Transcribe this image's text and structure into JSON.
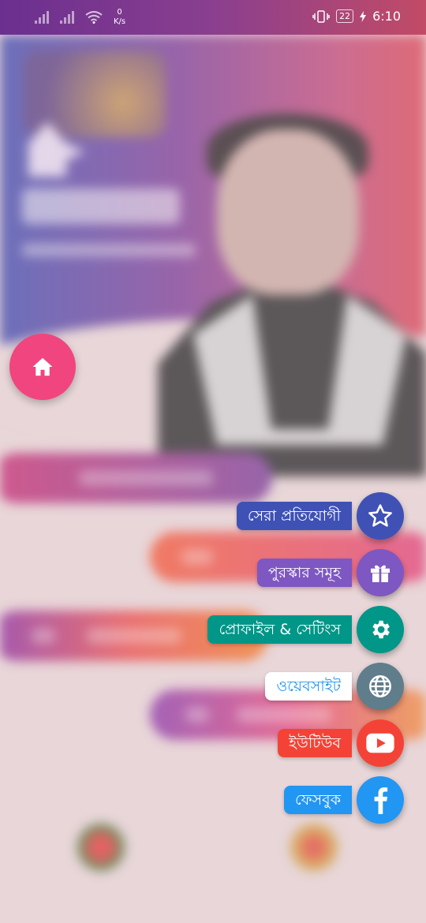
{
  "status_bar": {
    "net_speed_value": "0",
    "net_speed_unit": "K/s",
    "battery": "22",
    "time": "6:10"
  },
  "home_button": {
    "icon": "home-icon",
    "color": "#f1457f"
  },
  "speed_dial": [
    {
      "label": "সেরা প্রতিযোগী",
      "icon": "star-icon",
      "label_bg": "#3f51b5",
      "label_fg": "#ffffff",
      "btn_bg": "#3f51b5"
    },
    {
      "label": "পুরস্কার সমূহ",
      "icon": "gift-icon",
      "label_bg": "#7e57c2",
      "label_fg": "#ffffff",
      "btn_bg": "#7e57c2"
    },
    {
      "label": "প্রোফাইল & সেটিংস",
      "icon": "gear-icon",
      "label_bg": "#009688",
      "label_fg": "#ffffff",
      "btn_bg": "#009688"
    },
    {
      "label": "ওয়েবসাইট",
      "icon": "globe-icon",
      "label_bg": "#ffffff",
      "label_fg": "#2196f3",
      "btn_bg": "#607d8b"
    },
    {
      "label": "ইউটিউব",
      "icon": "youtube-icon",
      "label_bg": "#f44336",
      "label_fg": "#ffffff",
      "btn_bg": "#f44336"
    },
    {
      "label": "ফেসবুক",
      "icon": "facebook-icon",
      "label_bg": "#2196f3",
      "label_fg": "#ffffff",
      "btn_bg": "#2196f3"
    }
  ]
}
